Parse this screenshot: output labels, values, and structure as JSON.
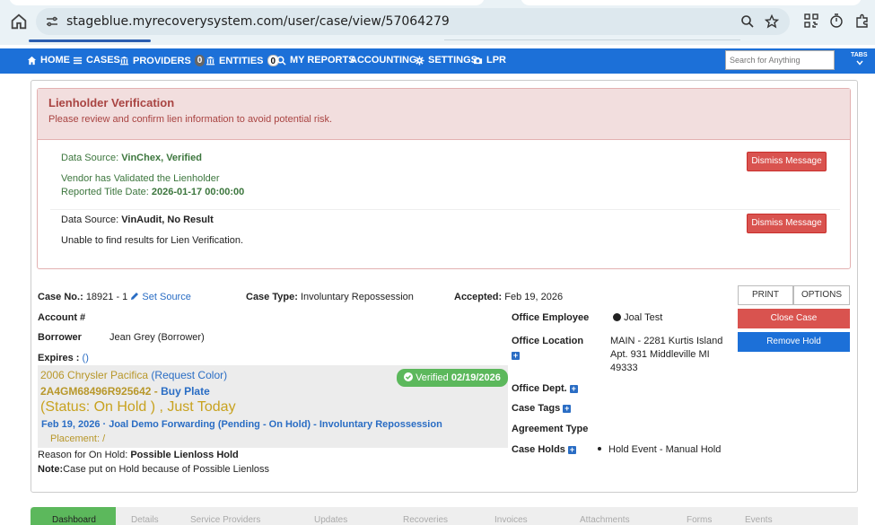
{
  "browser": {
    "url": "stageblue.myrecoverysystem.com/user/case/view/57064279"
  },
  "nav": {
    "items": [
      {
        "label": "HOME",
        "icon": "home-icon"
      },
      {
        "label": "CASES",
        "icon": "list-icon"
      },
      {
        "label": "PROVIDERS",
        "icon": "bank-icon",
        "badge": "0"
      },
      {
        "label": "ENTITIES",
        "icon": "bank-icon",
        "badge": "0"
      },
      {
        "label": "MY REPORTS",
        "icon": "search-icon"
      },
      {
        "label": "ACCOUNTING"
      },
      {
        "label": "SETTINGS",
        "icon": "gear-icon"
      },
      {
        "label": "LPR",
        "icon": "camera-icon"
      }
    ],
    "search_placeholder": "Search for Anything",
    "tabs_label": "TABS"
  },
  "alert": {
    "title": "Lienholder Verification",
    "subtitle": "Please review and confirm lien information to avoid potential risk.",
    "msg1_source_label": "Data Source: ",
    "msg1_source_value": "VinChex, Verified",
    "msg1_line2": "Vendor has Validated the Lienholder",
    "msg1_line3_label": "Reported Title Date: ",
    "msg1_line3_value": "2026-01-17 00:00:00",
    "msg2_source_label": "Data Source: ",
    "msg2_source_value": "VinAudit, No Result",
    "msg2_line2": "Unable to find results for Lien Verification.",
    "dismiss_label": "Dismiss Message"
  },
  "case": {
    "case_no_label": "Case No.:",
    "case_no": "18921 - 1",
    "set_source": "Set Source",
    "case_type_label": "Case Type:",
    "case_type": "Involuntary Repossession",
    "accepted_label": "Accepted:",
    "accepted": "Feb 19, 2026",
    "account_label": "Account #",
    "borrower_label": "Borrower",
    "borrower": "Jean Grey (Borrower)",
    "expires_label": "Expires :",
    "expires_value": "()",
    "vehicle_title": "2006 Chrysler Pacifica",
    "request_color": "(Request Color)",
    "vin": "2A4GM68496R925642",
    "buy_plate": "Buy Plate",
    "status": "(Status: On Hold ) , Just Today",
    "event": "Feb 19, 2026 · Joal Demo Forwarding (Pending - On Hold) - Involuntary Repossession",
    "placement": "Placement: /",
    "verified_label": "Verified",
    "verified_date": "02/19/2026",
    "hold_reason_label": "Reason for On Hold:",
    "hold_reason": "Possible Lienloss Hold",
    "note_label": "Note:",
    "note": "Case put on Hold because of Possible Lienloss",
    "office_employee_label": "Office Employee",
    "office_employee": "Joal Test",
    "office_location_label": "Office Location",
    "office_location_1": "MAIN - 2281 Kurtis Island",
    "office_location_2": "Apt. 931 Middleville MI",
    "office_location_3": "49333",
    "office_dept_label": "Office Dept.",
    "case_tags_label": "Case Tags",
    "agreement_type_label": "Agreement Type",
    "case_holds_label": "Case Holds",
    "case_hold_item": "Hold Event - Manual Hold"
  },
  "actions": {
    "print": "PRINT",
    "options": "OPTIONS",
    "close_case": "Close Case",
    "remove_hold": "Remove Hold"
  },
  "tabs": [
    {
      "label": "Dashboard"
    },
    {
      "label": "Details"
    },
    {
      "label": "Service Providers"
    },
    {
      "label": "Updates"
    },
    {
      "label": "Recoveries"
    },
    {
      "label": "Invoices"
    },
    {
      "label": "Attachments"
    },
    {
      "label": "Forms"
    },
    {
      "label": "Events"
    }
  ],
  "colors": {
    "nav": "#1c70d8",
    "alert_bg": "#f2dede",
    "alert_text": "#a94442",
    "success": "#3c763d",
    "danger": "#d9534f",
    "vehicle_gold": "#b8972a",
    "link": "#2a6dc4",
    "verified": "#5cb85c"
  }
}
